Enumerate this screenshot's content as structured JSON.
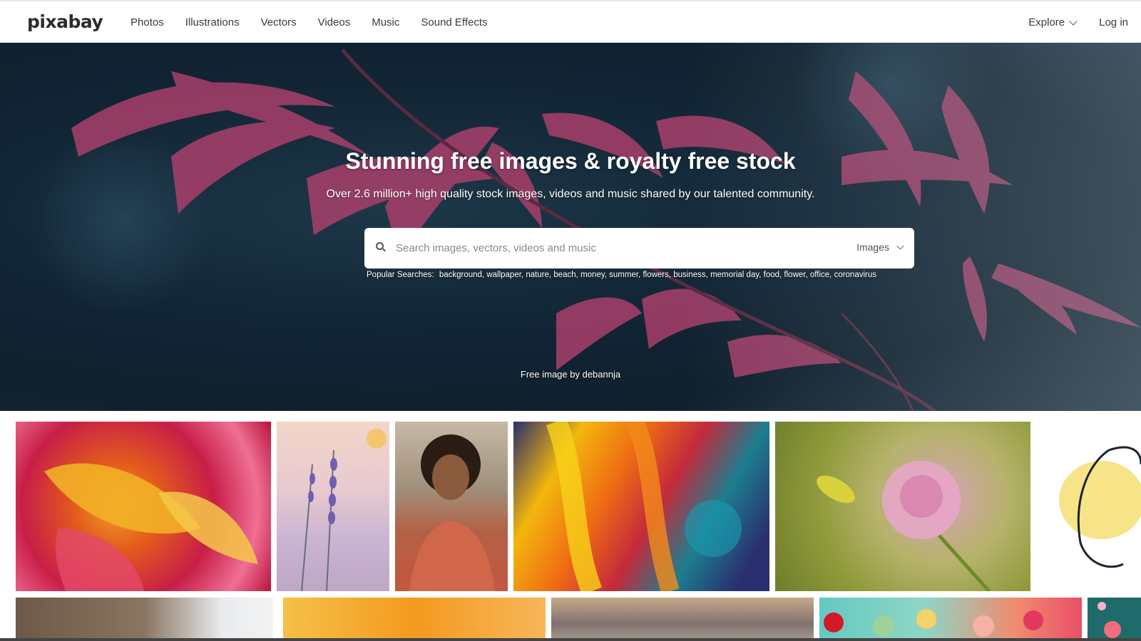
{
  "brand": {
    "logo": "pixabay"
  },
  "nav": {
    "items": [
      "Photos",
      "Illustrations",
      "Vectors",
      "Videos",
      "Music",
      "Sound Effects"
    ],
    "explore": "Explore",
    "login": "Log in"
  },
  "hero": {
    "title": "Stunning free images & royalty free stock",
    "subtitle": "Over 2.6 million+ high quality stock images, videos and music shared by our talented community.",
    "search_placeholder": "Search images, vectors, videos and music",
    "search_type": "Images",
    "popular_label": "Popular Searches:",
    "popular_terms": [
      "background,",
      "wallpaper,",
      "nature,",
      "beach,",
      "money,",
      "summer,",
      "flowers,",
      "business,",
      "memorial day,",
      "food,",
      "flower,",
      "office,",
      "coronavirus"
    ],
    "credit": "Free image by debannja"
  },
  "colors": {
    "brand_text": "#2c2c2c",
    "hero_bg": "#122636",
    "leaf": "#b0466f"
  }
}
